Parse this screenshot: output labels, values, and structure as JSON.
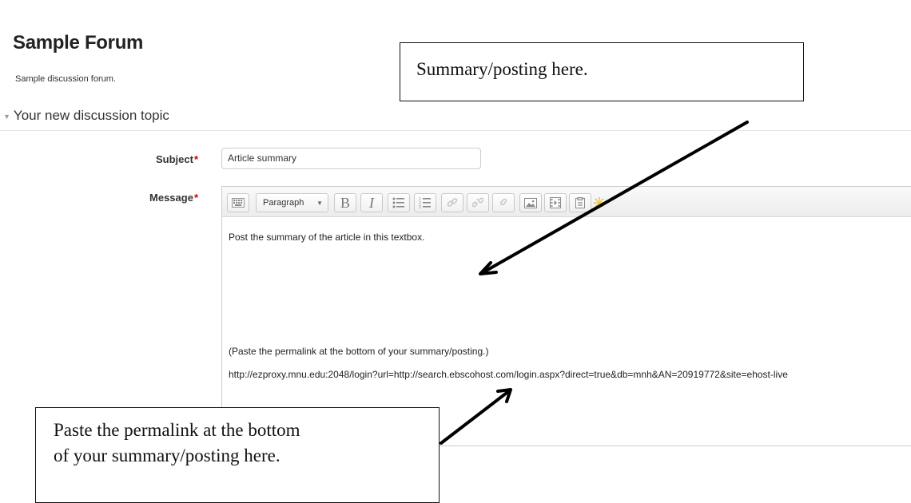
{
  "forum": {
    "title": "Sample Forum",
    "description": "Sample discussion forum."
  },
  "section": {
    "legend": "Your new discussion topic"
  },
  "form": {
    "subject_label": "Subject",
    "subject_value": "Article summary",
    "message_label": "Message",
    "required_marker": "*"
  },
  "editor": {
    "toolbar": {
      "format_select": "Paragraph",
      "buttons": [
        {
          "name": "toolbar-toggle",
          "icon": "keyboard-icon"
        },
        {
          "name": "bold",
          "label": "B",
          "icon": "bold-icon"
        },
        {
          "name": "italic",
          "label": "I",
          "icon": "italic-icon"
        },
        {
          "name": "unordered-list",
          "icon": "bullet-list-icon"
        },
        {
          "name": "ordered-list",
          "icon": "numbered-list-icon"
        },
        {
          "name": "link",
          "icon": "link-icon"
        },
        {
          "name": "unlink",
          "icon": "unlink-icon"
        },
        {
          "name": "anchor",
          "icon": "anchor-icon"
        },
        {
          "name": "image",
          "icon": "image-icon"
        },
        {
          "name": "media",
          "icon": "media-icon"
        },
        {
          "name": "paste",
          "icon": "paste-icon"
        },
        {
          "name": "spellcheck",
          "icon": "spellcheck-icon"
        }
      ]
    },
    "content": {
      "line1": "Post the summary of the article in this textbox.",
      "line2": "(Paste the permalink at the bottom of your summary/posting.)",
      "line3": "http://ezproxy.mnu.edu:2048/login?url=http://search.ebscohost.com/login.aspx?direct=true&db=mnh&AN=20919772&site=ehost-live"
    }
  },
  "callouts": {
    "top": "Summary/posting here.",
    "bottom_line1": "Paste the permalink at the bottom",
    "bottom_line2": "of your summary/posting here."
  },
  "colors": {
    "required": "#cc0000",
    "callout_border": "#111111",
    "arrow": "#000000"
  }
}
